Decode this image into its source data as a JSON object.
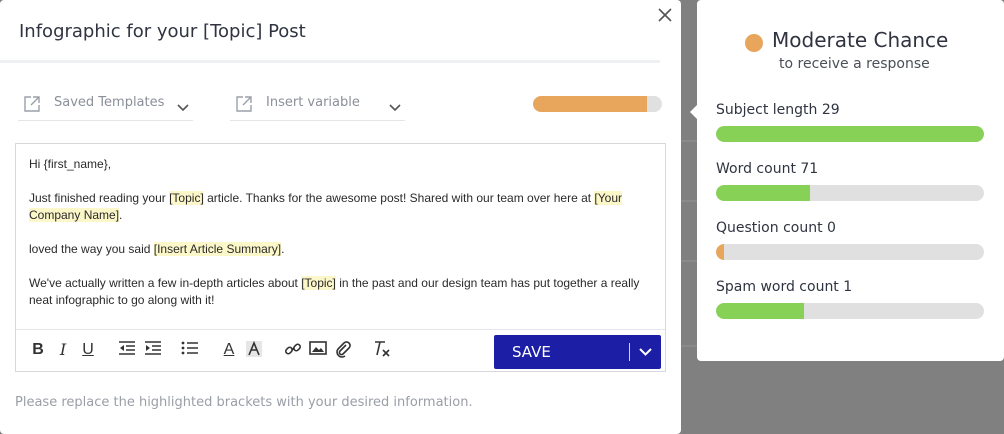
{
  "modal": {
    "title": "Infographic for your [Topic] Post",
    "close_icon": "close-icon"
  },
  "dropdowns": {
    "templates": {
      "label": "Saved Templates",
      "icon": "external-link-icon"
    },
    "variable": {
      "label": "Insert variable",
      "icon": "external-link-icon"
    }
  },
  "score": {
    "fill_fraction": 0.88,
    "color": "#e8a55c"
  },
  "editor": {
    "greeting": "Hi {first_name},",
    "p2_a": "Just finished reading your ",
    "p2_topic": "[Topic]",
    "p2_b": " article. Thanks for the awesome post! Shared with our team over here at ",
    "p2_company": "[Your Company Name]",
    "p2_c": ".",
    "p3_a": "loved the way you said ",
    "p3_summary": "[Insert Article Summary]",
    "p3_b": ".",
    "p4_a": "We've actually written a few in-depth articles about ",
    "p4_topic": "[Topic]",
    "p4_b": " in the past and our design team has put together a really neat infographic to go along with it!"
  },
  "toolbar": {
    "bold": "B",
    "italic": "I",
    "underline": "U",
    "text_color": "A",
    "save_label": "SAVE"
  },
  "footer_note": "Please replace the highlighted brackets with your desired information.",
  "panel": {
    "chance_title": "Moderate Chance",
    "chance_sub": "to receive a response",
    "chance_color": "#e8a55c",
    "metrics": [
      {
        "label": "Subject length 29",
        "fill_fraction": 1.0,
        "color": "#88d157"
      },
      {
        "label": "Word count 71",
        "fill_fraction": 0.35,
        "color": "#88d157"
      },
      {
        "label": "Question count 0",
        "fill_fraction": 0.03,
        "color": "#e8a55c"
      },
      {
        "label": "Spam word count 1",
        "fill_fraction": 0.33,
        "color": "#88d157"
      }
    ]
  }
}
